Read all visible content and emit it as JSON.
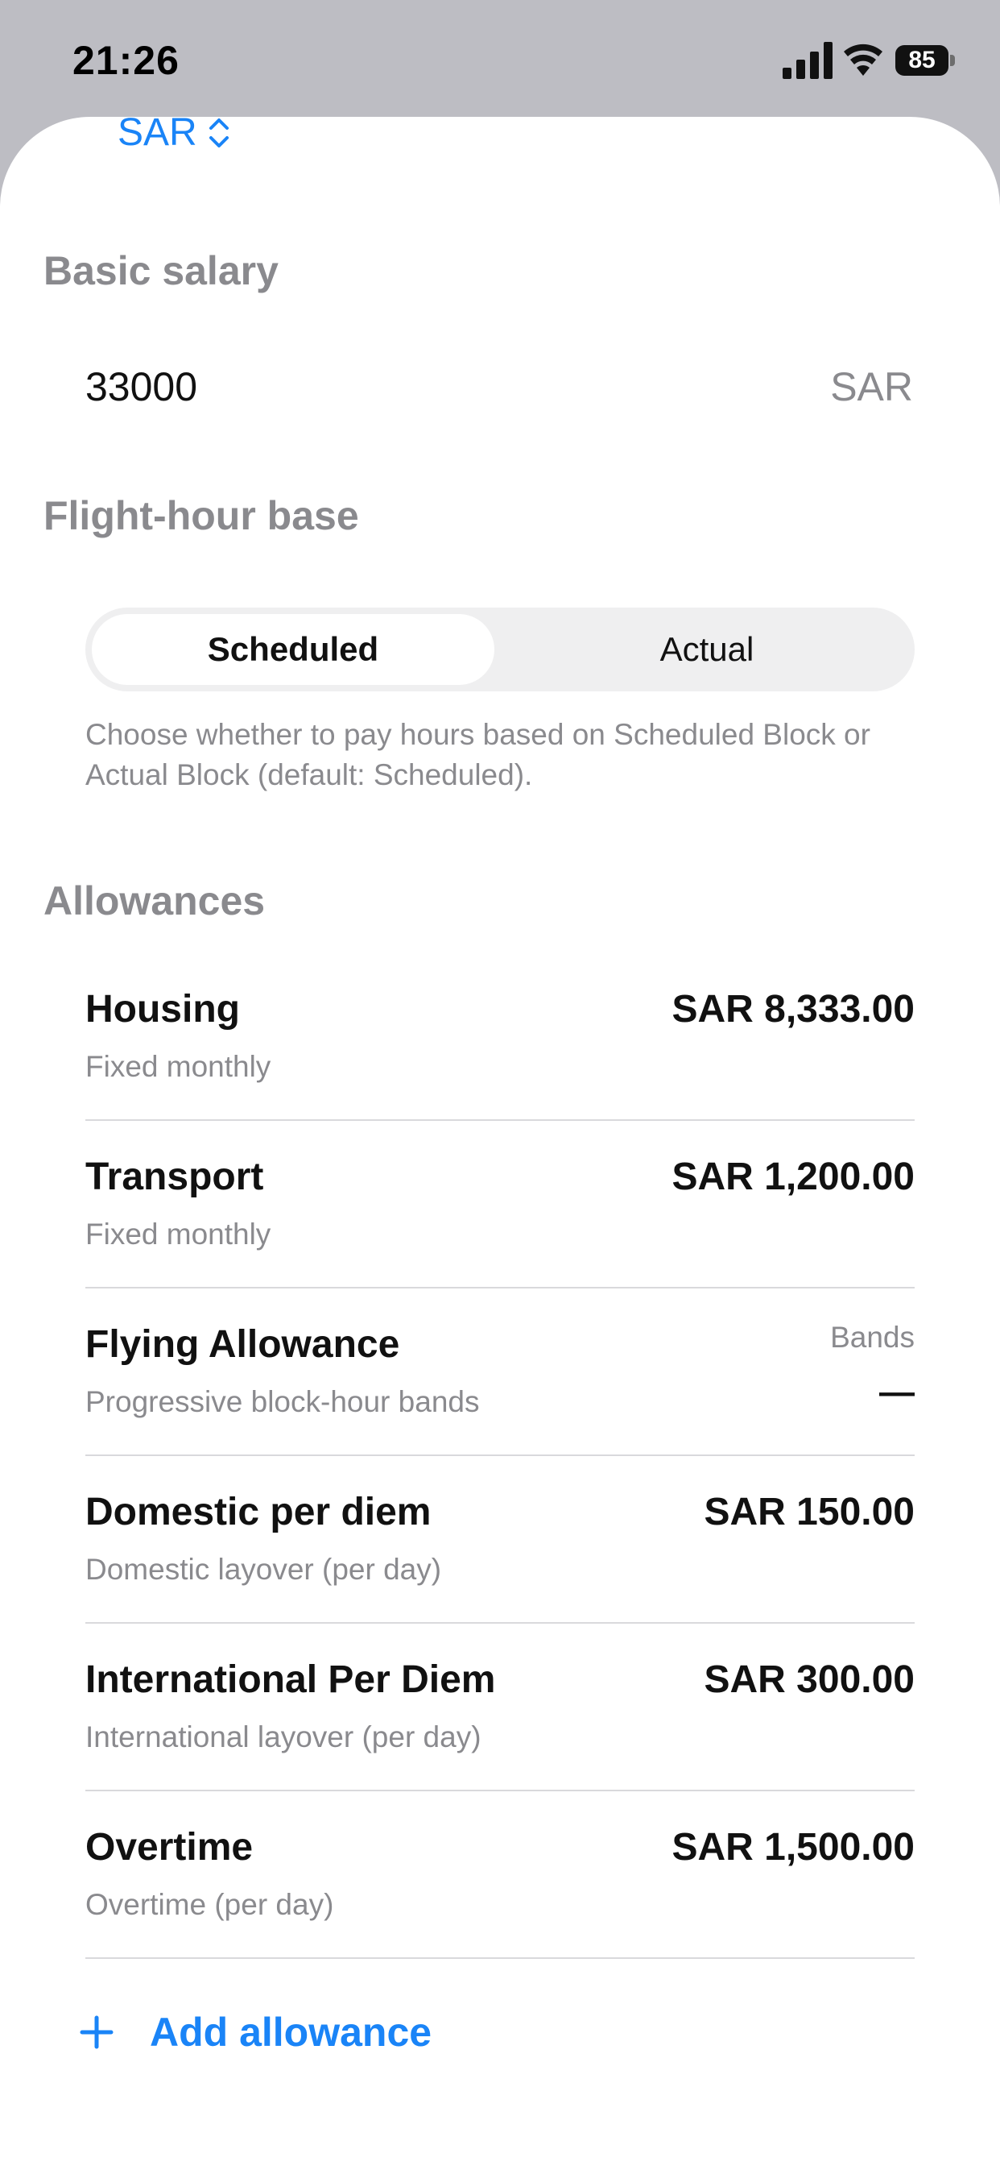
{
  "status_bar": {
    "time": "21:26",
    "battery": "85"
  },
  "header": {
    "currency": "SAR"
  },
  "basic_salary": {
    "title": "Basic salary",
    "value": "33000",
    "unit": "SAR"
  },
  "flight_hour_base": {
    "title": "Flight-hour base",
    "options": [
      "Scheduled",
      "Actual"
    ],
    "selected": "Scheduled",
    "footnote": "Choose whether to pay hours based on Scheduled Block or Actual Block (default: Scheduled)."
  },
  "allowances": {
    "title": "Allowances",
    "items": [
      {
        "name": "Housing",
        "subtitle": "Fixed monthly",
        "amount": "SAR 8,333.00"
      },
      {
        "name": "Transport",
        "subtitle": "Fixed monthly",
        "amount": "SAR 1,200.00"
      },
      {
        "name": "Flying Allowance",
        "subtitle": "Progressive block-hour bands",
        "label": "Bands",
        "amount": "—"
      },
      {
        "name": "Domestic per diem",
        "subtitle": "Domestic layover (per day)",
        "amount": "SAR 150.00"
      },
      {
        "name": "International Per Diem",
        "subtitle": "International layover (per day)",
        "amount": "SAR 300.00"
      },
      {
        "name": "Overtime",
        "subtitle": "Overtime (per day)",
        "amount": "SAR 1,500.00"
      }
    ],
    "add_label": "Add allowance"
  },
  "colors": {
    "accent": "#1a84f7",
    "secondary_text": "#8a8a8e",
    "sheet": "#ffffff",
    "backdrop": "#bdbdc3"
  }
}
